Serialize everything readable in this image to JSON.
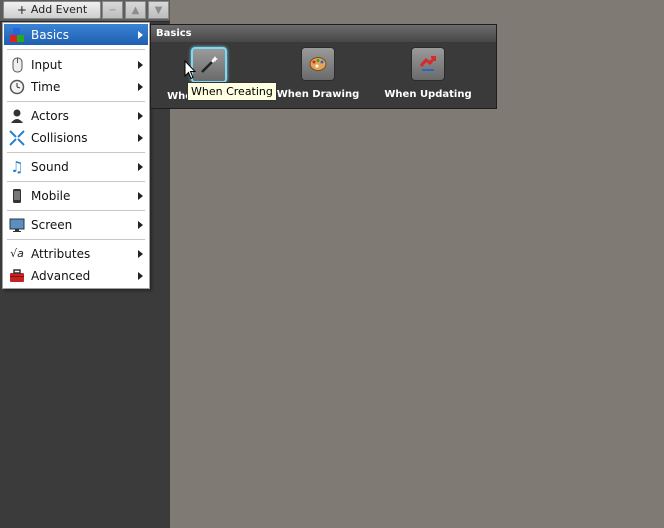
{
  "toolbar": {
    "add_event_label": "Add Event",
    "remove_glyph": "−",
    "up_glyph": "▲",
    "down_glyph": "▼"
  },
  "menu": {
    "items": [
      {
        "label": "Basics",
        "icon": "blocks-icon",
        "selected": true
      },
      {
        "label": "Input",
        "icon": "mouse-icon"
      },
      {
        "label": "Time",
        "icon": "clock-icon"
      },
      {
        "label": "Actors",
        "icon": "person-icon"
      },
      {
        "label": "Collisions",
        "icon": "arrows-icon"
      },
      {
        "label": "Sound",
        "icon": "music-note-icon"
      },
      {
        "label": "Mobile",
        "icon": "phone-icon"
      },
      {
        "label": "Screen",
        "icon": "monitor-icon"
      },
      {
        "label": "Attributes",
        "icon": "sqrt-icon",
        "icon_text": "√a"
      },
      {
        "label": "Advanced",
        "icon": "toolbox-icon"
      }
    ]
  },
  "basics_panel": {
    "title": "Basics",
    "events": [
      {
        "label": "When Creating",
        "icon": "magic-wand-icon",
        "highlighted": true
      },
      {
        "label": "When Drawing",
        "icon": "palette-icon"
      },
      {
        "label": "When Updating",
        "icon": "refresh-icon"
      }
    ]
  },
  "tooltip": "When Creating",
  "colors": {
    "selection": "#2a6fc2",
    "highlight": "#7fd8f2",
    "canvas": "#7f7b74",
    "panel": "#3b3b3b"
  }
}
